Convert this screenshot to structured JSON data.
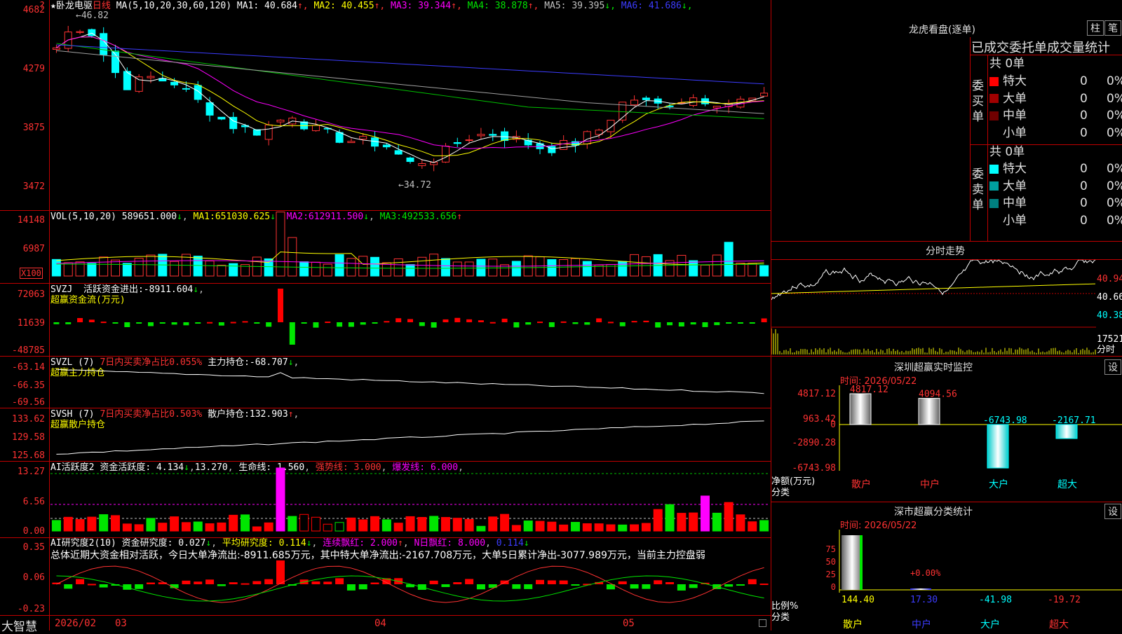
{
  "stock": {
    "star": "★",
    "name": "卧龙电驱",
    "period": "日线",
    "ma_params": "MA(5,10,20,30,60,120)"
  },
  "price_panel": {
    "ma": [
      {
        "label": "MA1:",
        "value": "40.684",
        "arrow": "↑",
        "color": "#ffffff"
      },
      {
        "label": "MA2:",
        "value": "40.455",
        "arrow": "↑",
        "color": "#ffff00"
      },
      {
        "label": "MA3:",
        "value": "39.344",
        "arrow": "↑",
        "color": "#ff00ff"
      },
      {
        "label": "MA4:",
        "value": "38.878",
        "arrow": "↑",
        "color": "#00e600"
      },
      {
        "label": "MA5:",
        "value": "39.395",
        "arrow": "↓",
        "color": "#c0c0c0"
      },
      {
        "label": "MA6:",
        "value": "41.686",
        "arrow": "↓",
        "color": "#3c3cff"
      }
    ],
    "y_ticks": [
      "4682",
      "4279",
      "3875",
      "3472"
    ],
    "high_label": "46.82",
    "low_label": "34.72"
  },
  "vol_panel": {
    "header": "VOL(5,10,20)",
    "value": "589651.000",
    "arrow": "↓",
    "ma1": "651030.625",
    "ma2": "612911.500",
    "ma3": "492533.656",
    "ma1_label": "MA1:",
    "ma2_label": "MA2:",
    "ma3_label": "MA3:",
    "y_ticks": [
      "14148",
      "6987"
    ],
    "unit": "X100"
  },
  "svzj": {
    "code": "SVZJ",
    "label": "活跃资金进出:",
    "value": "-8911.604",
    "arrow": "↓",
    "sub": "超赢资金流(万元)",
    "y_ticks": [
      "72063",
      "11639",
      "-48785"
    ]
  },
  "svzl": {
    "code": "SVZL (7)",
    "label": "7日内买卖净占比0.055%",
    "label2": "主力持仓:",
    "value": "-68.707",
    "arrow": "↓",
    "sub": "超赢主力持仓",
    "y_ticks": [
      "-63.14",
      "-66.35",
      "-69.56"
    ]
  },
  "svsh": {
    "code": "SVSH (7)",
    "label": "7日内买卖净占比0.503%",
    "label2": "散户持仓:",
    "value": "132.903",
    "arrow": "↑",
    "sub": "超赢散户持仓",
    "y_ticks": [
      "133.62",
      "129.58",
      "125.68"
    ]
  },
  "ai_act": {
    "code": "AI活跃度2",
    "label": "资金活跃度:",
    "value": "4.134",
    "arrow": "↓",
    "v2": "13.270",
    "life_label": "生命线:",
    "life": "1.560",
    "strong": "强势线: 3.000",
    "burst": "爆发线: 6.000",
    "y_ticks": [
      "13.27",
      "6.56",
      "0.00"
    ]
  },
  "ai_res": {
    "code": "AI研究度2(10)",
    "label": "资金研究度:",
    "value": "0.027",
    "arrow": "↓",
    "avg_label": "平均研究度:",
    "avg": "0.114",
    "lx_label": "连续飘红:",
    "lx": "2.000",
    "n_label": "N日飘红:",
    "n": "8.000",
    "last": "0.114",
    "summary": "总体近期大资金相对活跃，今日大单净流出:-8911.685万元，其中特大单净流出:-2167.708万元，大单5日累计净出-3077.989万元，当前主力控盘弱",
    "y_ticks": [
      "0.35",
      "0.06",
      "-0.23"
    ]
  },
  "x_axis": [
    "2026/02",
    "03",
    "04",
    "05"
  ],
  "brand": "大智慧",
  "lhb": {
    "title": "龙虎看盘(逐单)",
    "tab1": "柱",
    "tab2": "笔",
    "subtitle": "已成交委托单成交量统计",
    "buy_label": "委买单",
    "sell_label": "委卖单",
    "buy_total": "共 0单",
    "sell_total": "共 0单",
    "buy": [
      {
        "name": "特大",
        "count": "0",
        "pct": "0%",
        "color": "#ff0000"
      },
      {
        "name": "大单",
        "count": "0",
        "pct": "0%",
        "color": "#a00000"
      },
      {
        "name": "中单",
        "count": "0",
        "pct": "0%",
        "color": "#700000"
      },
      {
        "name": "小单",
        "count": "0",
        "pct": "0%",
        "color": "#000000"
      }
    ],
    "sell": [
      {
        "name": "特大",
        "count": "0",
        "pct": "0%",
        "color": "#00ffff"
      },
      {
        "name": "大单",
        "count": "0",
        "pct": "0%",
        "color": "#00a0a0"
      },
      {
        "name": "中单",
        "count": "0",
        "pct": "0%",
        "color": "#008080"
      },
      {
        "name": "小单",
        "count": "0",
        "pct": "0%",
        "color": "#000000"
      }
    ]
  },
  "intraday": {
    "title": "分时走势",
    "p1": "40.94",
    "p2": "40.66",
    "p3": "40.38",
    "vol": "17521",
    "unit": "分时"
  },
  "sz_monitor": {
    "title": "深圳超赢实时监控",
    "set": "设",
    "date": "时间: 2026/05/22",
    "y_ticks": [
      "4817.12",
      "963.42",
      "0",
      "-2890.28",
      "-6743.98"
    ],
    "ylabel1": "净额(万元)",
    "ylabel2": "分类",
    "cats": [
      "散户",
      "中户",
      "大户",
      "超大"
    ],
    "values_label": [
      "4817.12",
      "4094.56",
      "-6743.98",
      "-2167.71"
    ],
    "values": [
      4817.12,
      4094.56,
      -6743.98,
      -2167.71
    ]
  },
  "sz_class": {
    "title": "深市超赢分类统计",
    "set": "设",
    "date": "时间: 2026/05/22",
    "y_ticks": [
      "75",
      "50",
      "25",
      "0"
    ],
    "ylabel1": "比例%",
    "ylabel2": "分类",
    "cats": [
      "散户",
      "中户",
      "大户",
      "超大"
    ],
    "values_label": [
      "144.40",
      "17.30",
      "-41.98",
      "-19.72"
    ],
    "values": [
      144.4,
      17.3,
      -41.98,
      -19.72
    ],
    "mid_label": "+0.00%"
  }
}
